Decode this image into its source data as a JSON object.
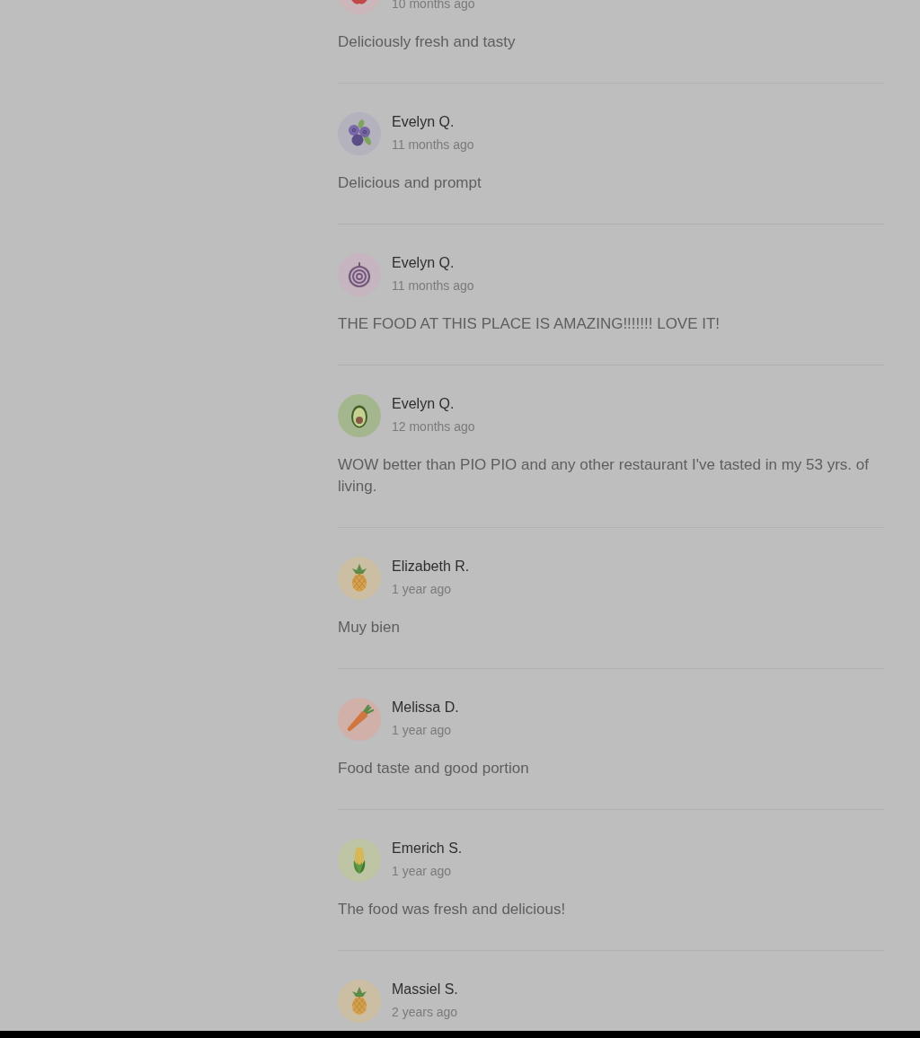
{
  "reviews": [
    {
      "avatar": {
        "kind": "apple"
      },
      "time": "10 months ago",
      "text": "Deliciously fresh and tasty"
    },
    {
      "avatar": {
        "kind": "blueberries"
      },
      "name": "Evelyn Q.",
      "time": "11 months ago",
      "text": "Delicious and prompt"
    },
    {
      "avatar": {
        "kind": "onion"
      },
      "name": "Evelyn Q.",
      "time": "11 months ago",
      "text": "THE FOOD AT THIS PLACE IS AMAZING!!!!!!! LOVE IT!"
    },
    {
      "avatar": {
        "kind": "avocado"
      },
      "name": "Evelyn Q.",
      "time": "12 months ago",
      "text": "WOW better than PIO PIO and any other restaurant I've tasted in my 53 yrs. of living."
    },
    {
      "avatar": {
        "kind": "pineapple"
      },
      "name": "Elizabeth R.",
      "time": "1 year ago",
      "text": "Muy bien"
    },
    {
      "avatar": {
        "kind": "carrot"
      },
      "name": "Melissa D.",
      "time": "1 year ago",
      "text": "Food taste and good portion"
    },
    {
      "avatar": {
        "kind": "corn"
      },
      "name": "Emerich S.",
      "time": "1 year ago",
      "text": "The food was fresh and delicious!"
    },
    {
      "avatar": {
        "kind": "pineapple"
      },
      "name": "Massiel S.",
      "time": "2 years ago"
    }
  ]
}
